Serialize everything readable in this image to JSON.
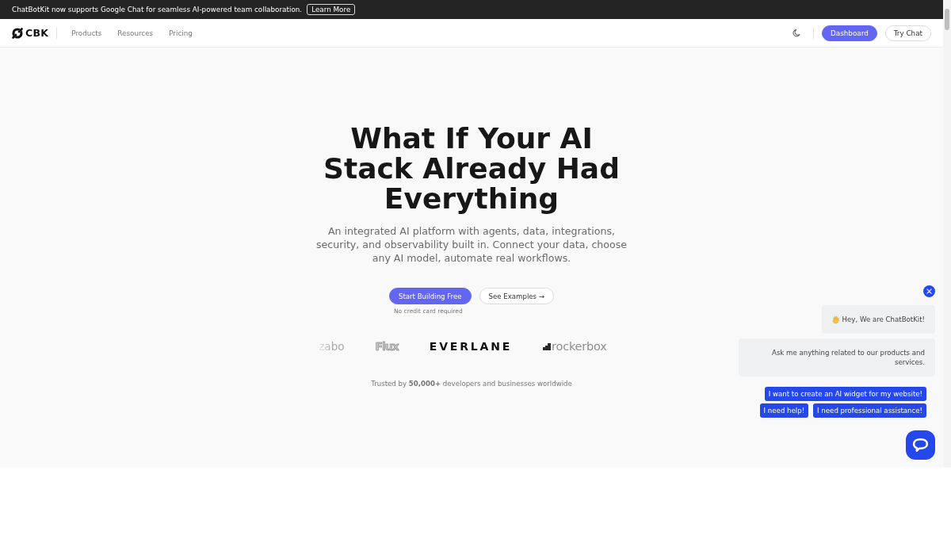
{
  "announcement": {
    "text": "ChatBotKit now supports Google Chat for seamless AI-powered team collaboration.",
    "link": "Learn More"
  },
  "nav": {
    "logo": "CBK",
    "links": [
      {
        "label": "Products"
      },
      {
        "label": "Resources"
      },
      {
        "label": "Pricing"
      }
    ],
    "buttons": [
      {
        "label": "Dashboard",
        "kind": "primary"
      },
      {
        "label": "Try Chat",
        "kind": "outline"
      }
    ]
  },
  "hero": {
    "title": "What If Your AI Stack Already Had Everything",
    "subtitle": "An integrated AI platform with agents, data, integrations, security, and observability built in. Connect your data, choose any AI model, automate real workflows.",
    "actions": [
      {
        "label": "Start Building Free",
        "kind": "primary"
      },
      {
        "label": "See Examples →",
        "kind": "outline"
      }
    ],
    "note": "No credit card required",
    "logos": [
      {
        "label": "zabo",
        "kind": "faded"
      },
      {
        "label": "Flux",
        "kind": "outline"
      },
      {
        "label": "EVERLANE",
        "kind": "wordmark"
      },
      {
        "label": "rockerbox",
        "kind": "mark"
      }
    ],
    "trust": "Trusted by **50,000+** developers and businesses worldwide"
  },
  "chat_widget": {
    "messages": [
      {
        "text": "Hey, We are ChatBotKit!",
        "kind": "greeting"
      },
      {
        "text": "Ask me anything related to our products and services.",
        "kind": "text"
      }
    ],
    "suggestions": [
      {
        "label": "I want to create an AI widget for my website!"
      },
      {
        "label": "I need help!"
      },
      {
        "label": "I need professional assistance!"
      }
    ]
  }
}
